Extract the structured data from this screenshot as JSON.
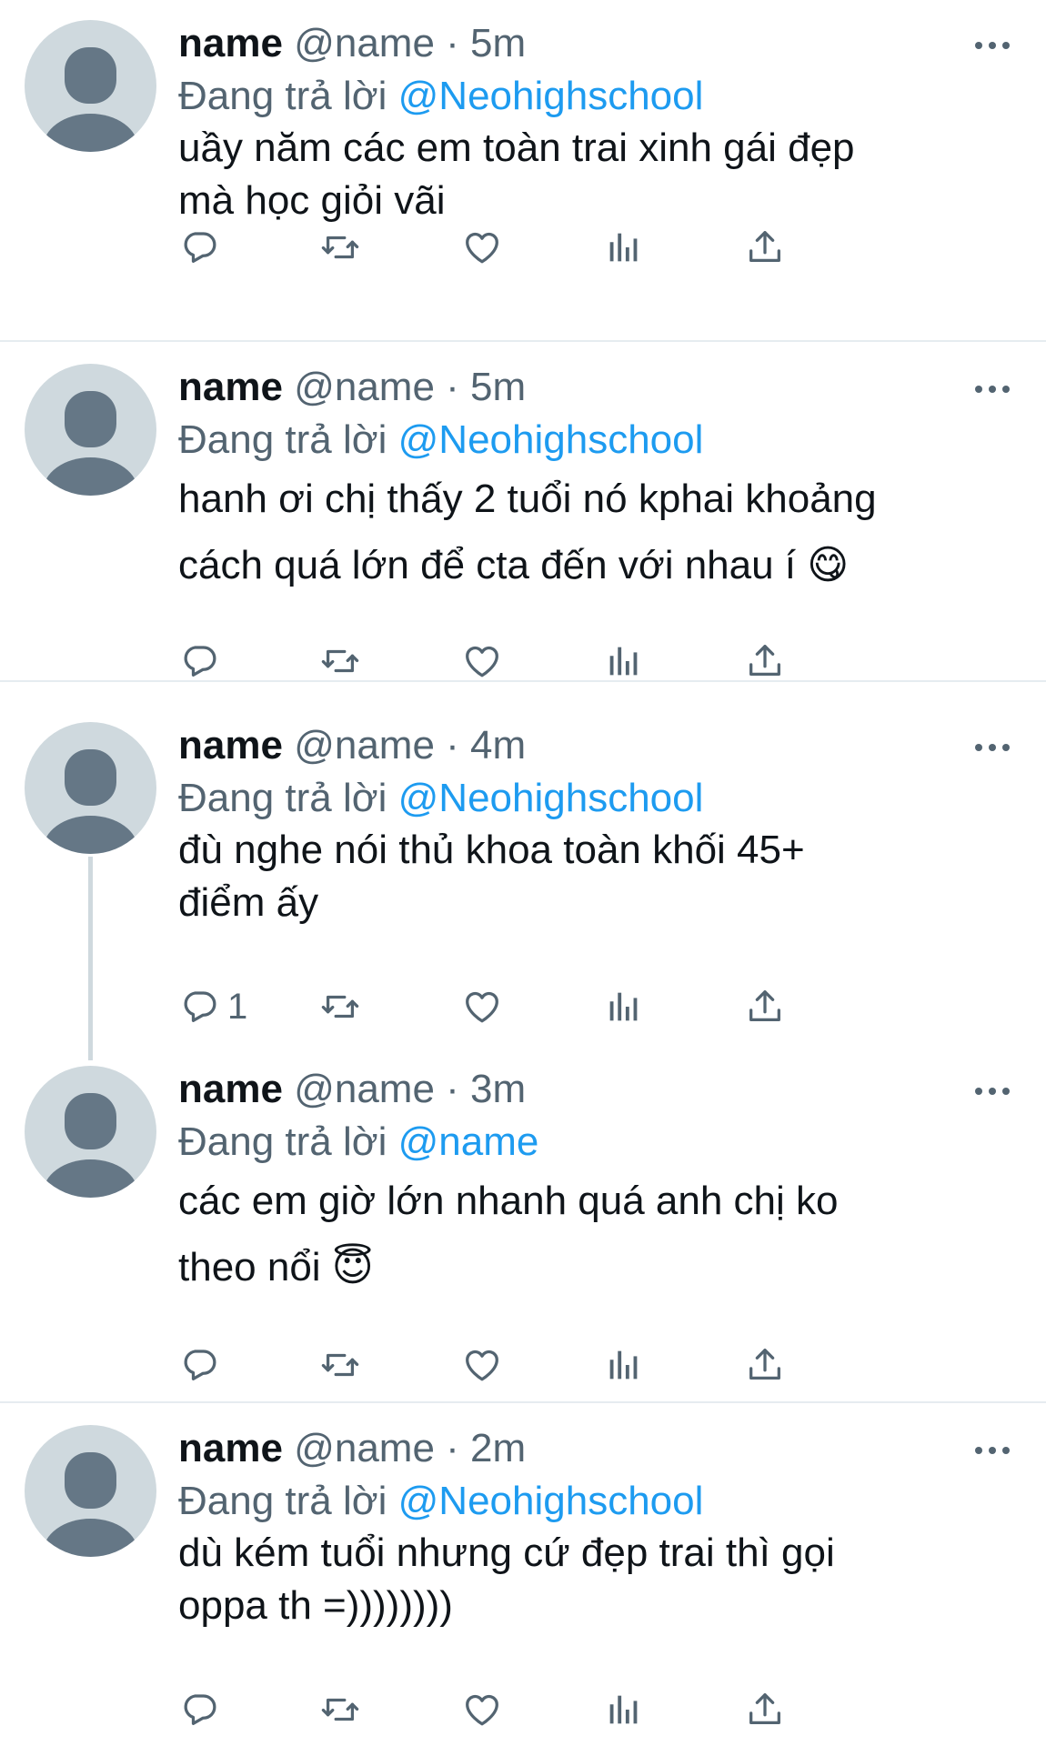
{
  "tweets": [
    {
      "name": "name",
      "handle": "@name",
      "sep": "·",
      "time": "5m",
      "reply_prefix": "Đang trả lời",
      "reply_to": "@Neohighschool",
      "text": "uầy năm các em toàn trai xinh gái đẹp\nmà học giỏi vãi",
      "reply_count": ""
    },
    {
      "name": "name",
      "handle": "@name",
      "sep": "·",
      "time": "5m",
      "reply_prefix": "Đang trả lời",
      "reply_to": "@Neohighschool",
      "text": "hanh ơi chị thấy 2 tuổi nó kphai khoảng\ncách quá lớn để cta đến với nhau í 😋",
      "reply_count": ""
    },
    {
      "name": "name",
      "handle": "@name",
      "sep": "·",
      "time": "4m",
      "reply_prefix": "Đang trả lời",
      "reply_to": "@Neohighschool",
      "text": "đù nghe nói thủ khoa toàn khối 45+\nđiểm ấy",
      "reply_count": "1"
    },
    {
      "name": "name",
      "handle": "@name",
      "sep": "·",
      "time": "3m",
      "reply_prefix": "Đang trả lời",
      "reply_to": "@name",
      "text": "các em giờ lớn nhanh quá anh chị ko\ntheo nổi 😇",
      "reply_count": ""
    },
    {
      "name": "name",
      "handle": "@name",
      "sep": "·",
      "time": "2m",
      "reply_prefix": "Đang trả lời",
      "reply_to": "@Neohighschool",
      "text": "dù kém tuổi nhưng cứ đẹp trai thì gọi\noppa th =))))))))",
      "reply_count": ""
    }
  ],
  "icons": {
    "reply": "reply-icon",
    "retweet": "retweet-icon",
    "like": "heart-icon",
    "analytics": "analytics-icon",
    "share": "share-icon",
    "more": "more-icon"
  },
  "colors": {
    "text": "#0f1419",
    "secondary": "#536471",
    "link": "#1d9bf0",
    "avatar_bg": "#cfd9de",
    "avatar_fg": "#657786",
    "divider": "#e6ecf0"
  }
}
